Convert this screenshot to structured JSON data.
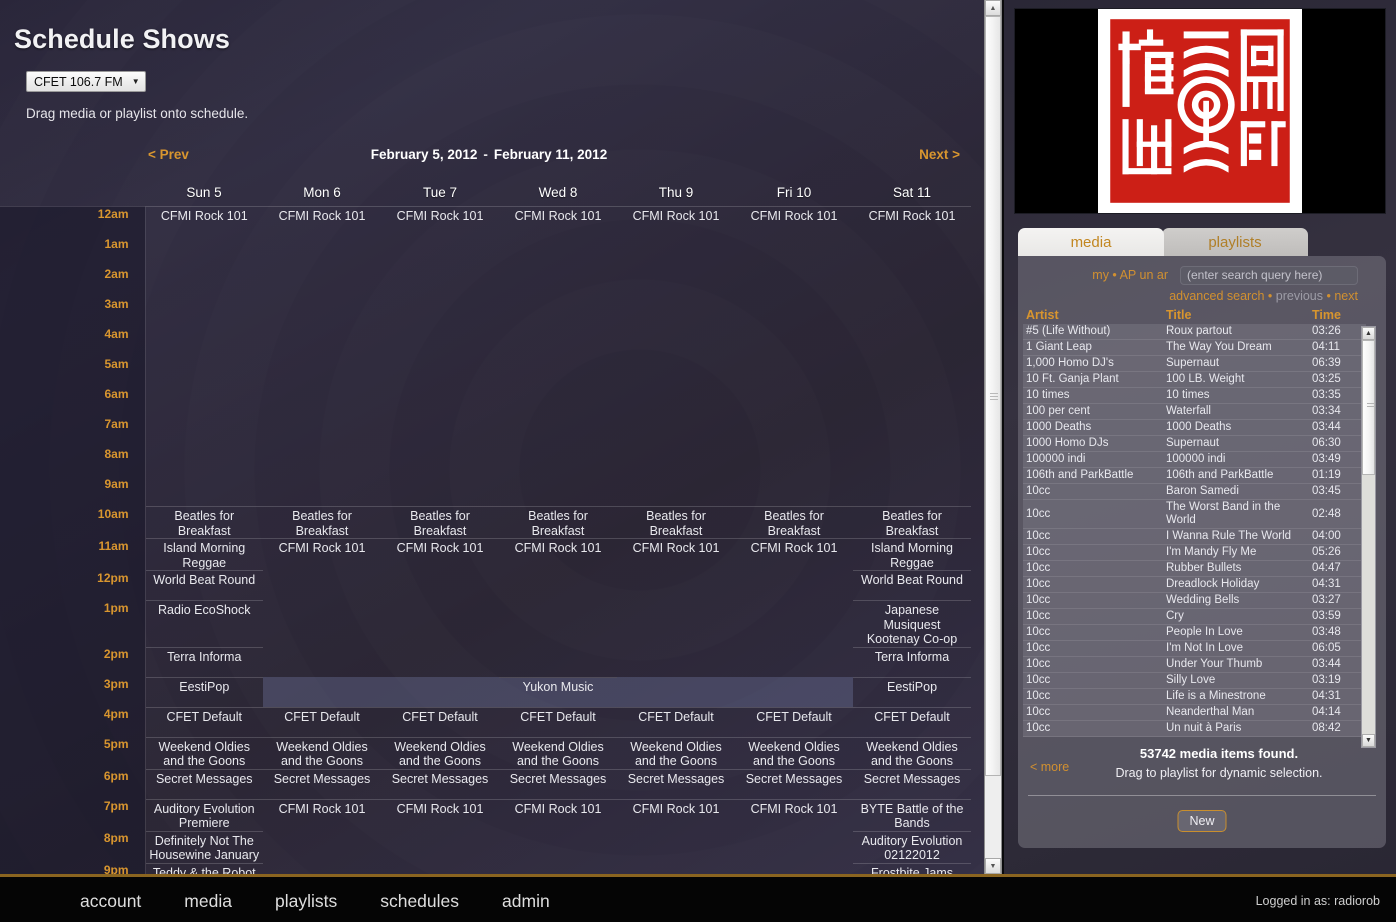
{
  "page": {
    "title": "Schedule Shows",
    "station_selected": "CFET 106.7 FM",
    "drag_hint": "Drag media or playlist onto schedule.",
    "caret": "▼"
  },
  "week_nav": {
    "prev": "< Prev",
    "next": "Next >",
    "start": "February 5, 2012",
    "dash": "-",
    "end": "February 11, 2012"
  },
  "schedule": {
    "days": [
      "Sun 5",
      "Mon 6",
      "Tue 7",
      "Wed 8",
      "Thu 9",
      "Fri 10",
      "Sat 11"
    ],
    "hours": [
      "12am",
      "1am",
      "2am",
      "3am",
      "4am",
      "5am",
      "6am",
      "7am",
      "8am",
      "9am",
      "10am",
      "11am",
      "12pm",
      "1pm",
      "2pm",
      "3pm",
      "4pm",
      "5pm",
      "6pm",
      "7pm",
      "8pm",
      "9pm"
    ],
    "rows": [
      {
        "hour": "12am",
        "cells": [
          "CFMI Rock 101",
          "CFMI Rock 101",
          "CFMI Rock 101",
          "CFMI Rock 101",
          "CFMI Rock 101",
          "CFMI Rock 101",
          "CFMI Rock 101"
        ]
      },
      {
        "hour": "1am",
        "cells": [
          "",
          "",
          "",
          "",
          "",
          "",
          ""
        ]
      },
      {
        "hour": "2am",
        "cells": [
          "",
          "",
          "",
          "",
          "",
          "",
          ""
        ]
      },
      {
        "hour": "3am",
        "cells": [
          "",
          "",
          "",
          "",
          "",
          "",
          ""
        ]
      },
      {
        "hour": "4am",
        "cells": [
          "",
          "",
          "",
          "",
          "",
          "",
          ""
        ]
      },
      {
        "hour": "5am",
        "cells": [
          "",
          "",
          "",
          "",
          "",
          "",
          ""
        ]
      },
      {
        "hour": "6am",
        "cells": [
          "",
          "",
          "",
          "",
          "",
          "",
          ""
        ]
      },
      {
        "hour": "7am",
        "cells": [
          "",
          "",
          "",
          "",
          "",
          "",
          ""
        ]
      },
      {
        "hour": "8am",
        "cells": [
          "",
          "",
          "",
          "",
          "",
          "",
          ""
        ]
      },
      {
        "hour": "9am",
        "cells": [
          "",
          "",
          "",
          "",
          "",
          "",
          ""
        ]
      },
      {
        "hour": "10am",
        "cells": [
          "Beatles for Breakfast",
          "Beatles for Breakfast",
          "Beatles for Breakfast",
          "Beatles for Breakfast",
          "Beatles for Breakfast",
          "Beatles for Breakfast",
          "Beatles for Breakfast"
        ]
      },
      {
        "hour": "11am",
        "cells": [
          "Island Morning Reggae",
          "CFMI Rock 101",
          "CFMI Rock 101",
          "CFMI Rock 101",
          "CFMI Rock 101",
          "CFMI Rock 101",
          "Island Morning Reggae"
        ]
      },
      {
        "hour": "12pm",
        "cells": [
          "World Beat Round",
          "",
          "",
          "",
          "",
          "",
          "World Beat Round"
        ]
      },
      {
        "hour": "1pm",
        "cells": [
          "Radio EcoShock",
          "",
          "",
          "",
          "",
          "",
          "Japanese Musiquest Kootenay Co-op"
        ]
      },
      {
        "hour": "2pm",
        "cells": [
          "Terra Informa",
          "",
          "",
          "",
          "",
          "",
          "Terra Informa"
        ]
      },
      {
        "hour": "3pm",
        "cells": [
          "EestiPop",
          "",
          "",
          "Yukon Music",
          "",
          "",
          "EestiPop"
        ]
      },
      {
        "hour": "4pm",
        "cells": [
          "CFET Default",
          "CFET Default",
          "CFET Default",
          "CFET Default",
          "CFET Default",
          "CFET Default",
          "CFET Default"
        ]
      },
      {
        "hour": "5pm",
        "cells": [
          "Weekend Oldies and the Goons",
          "Weekend Oldies and the Goons",
          "Weekend Oldies and the Goons",
          "Weekend Oldies and the Goons",
          "Weekend Oldies and the Goons",
          "Weekend Oldies and the Goons",
          "Weekend Oldies and the Goons"
        ]
      },
      {
        "hour": "6pm",
        "cells": [
          "Secret Messages",
          "Secret Messages",
          "Secret Messages",
          "Secret Messages",
          "Secret Messages",
          "Secret Messages",
          "Secret Messages"
        ]
      },
      {
        "hour": "7pm",
        "cells": [
          "Auditory Evolution Premiere",
          "CFMI Rock 101",
          "CFMI Rock 101",
          "CFMI Rock 101",
          "CFMI Rock 101",
          "CFMI Rock 101",
          "BYTE Battle of the Bands"
        ]
      },
      {
        "hour": "8pm",
        "cells": [
          "Definitely Not The Housewine January",
          "",
          "",
          "",
          "",
          "",
          "Auditory Evolution 02122012"
        ]
      },
      {
        "hour": "9pm",
        "cells": [
          "Teddy & the Robot",
          "",
          "",
          "",
          "",
          "",
          "Frostbite Jams"
        ]
      }
    ]
  },
  "right": {
    "tabs": [
      {
        "label": "media",
        "active": true
      },
      {
        "label": "playlists",
        "active": false
      }
    ],
    "search": {
      "scope_links": "my • AP un ar",
      "placeholder": "(enter search query here)",
      "advanced": "advanced search",
      "previous": "previous",
      "next": "next",
      "dot": "•"
    },
    "table": {
      "headers": [
        "Artist",
        "Title",
        "Time"
      ],
      "rows": [
        [
          "#5 (Life Without)",
          "Roux partout",
          "03:26"
        ],
        [
          "1 Giant Leap",
          "The Way You Dream",
          "04:11"
        ],
        [
          "1,000 Homo DJ's",
          "Supernaut",
          "06:39"
        ],
        [
          "10 Ft. Ganja Plant",
          "100 LB. Weight",
          "03:25"
        ],
        [
          "10 times",
          "10 times",
          "03:35"
        ],
        [
          "100 per cent",
          "Waterfall",
          "03:34"
        ],
        [
          "1000 Deaths",
          "1000 Deaths",
          "03:44"
        ],
        [
          "1000 Homo DJs",
          "Supernaut",
          "06:30"
        ],
        [
          "100000 indi",
          "100000 indi",
          "03:49"
        ],
        [
          "106th and ParkBattle",
          "106th and ParkBattle",
          "01:19"
        ],
        [
          "10cc",
          "Baron Samedi",
          "03:45"
        ],
        [
          "10cc",
          "The Worst Band in the World",
          "02:48"
        ],
        [
          "10cc",
          "I Wanna Rule The World",
          "04:00"
        ],
        [
          "10cc",
          "I'm Mandy Fly Me",
          "05:26"
        ],
        [
          "10cc",
          "Rubber Bullets",
          "04:47"
        ],
        [
          "10cc",
          "Dreadlock Holiday",
          "04:31"
        ],
        [
          "10cc",
          "Wedding Bells",
          "03:27"
        ],
        [
          "10cc",
          "Cry",
          "03:59"
        ],
        [
          "10cc",
          "People In Love",
          "03:48"
        ],
        [
          "10cc",
          "I'm Not In Love",
          "06:05"
        ],
        [
          "10cc",
          "Under Your Thumb",
          "03:44"
        ],
        [
          "10cc",
          "Silly Love",
          "03:19"
        ],
        [
          "10cc",
          "Life is a Minestrone",
          "04:31"
        ],
        [
          "10cc",
          "Neanderthal Man",
          "04:14"
        ],
        [
          "10cc",
          "Un nuit à Paris",
          "08:42"
        ]
      ]
    },
    "footer": {
      "more": "< more",
      "count": "53742 media items found.",
      "hint": "Drag to playlist for dynamic selection.",
      "new_button": "New"
    }
  },
  "footer": {
    "links": [
      "account",
      "media",
      "playlists",
      "schedules",
      "admin"
    ],
    "logged_in": "Logged in as: radiorob"
  },
  "colors": {
    "accent_orange": "#d9962f",
    "text_light": "#e9e9ee",
    "footer_border": "#8b6520"
  }
}
